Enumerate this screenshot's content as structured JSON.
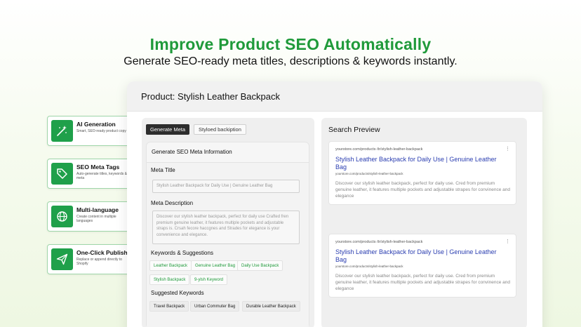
{
  "hero": {
    "title": "Improve Product SEO Automatically",
    "subtitle": "Generate SEO-ready meta titles, descriptions & keywords instantly."
  },
  "features": [
    {
      "title": "AI Generation",
      "desc": "Smart, SEO-ready product copy",
      "icon": "magic-wand-icon"
    },
    {
      "title": "SEO Meta Tags",
      "desc": "Auto-generate titles, keywords & meta",
      "icon": "tag-icon"
    },
    {
      "title": "Multi-language",
      "desc": "Create content in multiple languages",
      "icon": "globe-icon"
    },
    {
      "title": "One-Click Publish",
      "desc": "Replace or append directly to Shopify",
      "icon": "send-icon"
    }
  ],
  "panel": {
    "header": "Product: Stylish Leather Backpack",
    "tabs": [
      "Generate Meta",
      "Styloed backiption"
    ],
    "form_heading": "Generate SEO Meta Information",
    "meta_title_label": "Meta Title",
    "meta_title_value": "Stylish Leather Backpack for Daily Use | Genuine Leather Bag",
    "meta_desc_label": "Meta Description",
    "meta_desc_value": "Discover our stylish leather backpack, perfect for daily use Crafted fren premium genuine leather, it features multiple pockets and adjustable straps is. Crsah fecore haccgnes and Strades for elegance is your convenience and elegance.",
    "keywords_label": "Keywords & Suggestions",
    "keywords": [
      "Leather Backpack",
      "Genuine Leather Bag",
      "Daily Use Backpack",
      "Stylish Backpack",
      "9-ylsh Keyword"
    ],
    "suggested_label": "Suggested Keywords",
    "suggested": [
      "Travel Backpack",
      "Urban Commuter Bag",
      "Durable Leather Backpack"
    ]
  },
  "preview": {
    "title": "Search Preview",
    "results": [
      {
        "url": "yourstore.com/products /tr/stylish-leather-backpack",
        "title": "Stylish Leather Backpack for Daily Use | Genuine Leather Bag",
        "slug": "yourstore.com/products/stylish-leather-backpack",
        "desc": "Discover our stylish leather backpack, perfect for daily use. Cred from premium genuine leather, it features multiple pockets and adjustable strapes for convinence and elegance"
      },
      {
        "url": "yourstore.com/products /tr/stylish-leather-backpack",
        "title": "Stylish Leather Backpack for Daily Use | Genuine Leather Bag",
        "slug": "yourstore.com/products/stylish-leather-backpack",
        "desc": "Discover our stylish leather backpack, perfect for daily use. Cred from premium genuine leather, it features multiple pockets and adjustable strapes for convinence and elegance"
      }
    ]
  },
  "colors": {
    "accent": "#1f9a3a",
    "link": "#2a3db0",
    "icon_bg": "#1fa04a"
  }
}
